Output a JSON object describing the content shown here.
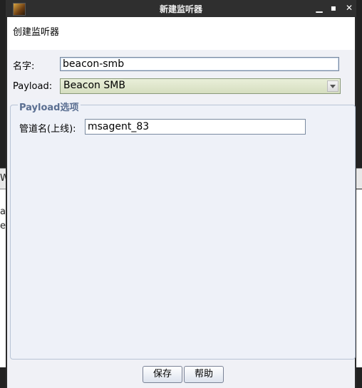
{
  "window": {
    "title": "新建监听器"
  },
  "header": {
    "text": "创建监听器"
  },
  "form": {
    "name_label": "名字:",
    "name_value": "beacon-smb",
    "payload_label": "Payload:",
    "payload_value": "Beacon SMB"
  },
  "payload_options": {
    "title": "Payload选项",
    "pipe_label": "管道名(上线):",
    "pipe_value": "msagent_83"
  },
  "buttons": {
    "save": "保存",
    "help": "帮助"
  },
  "background_fragments": {
    "left_chars": [
      "W",
      "a",
      "e"
    ]
  },
  "icons": {
    "minimize": "minimize-icon",
    "maximize": "maximize-icon",
    "close": "close-icon",
    "app": "app-icon"
  }
}
